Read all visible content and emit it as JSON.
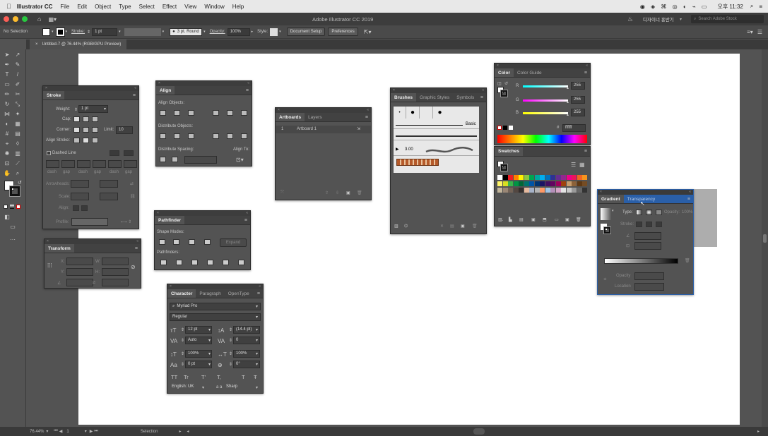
{
  "menubar": {
    "app": "Illustrator CC",
    "items": [
      "File",
      "Edit",
      "Object",
      "Type",
      "Select",
      "Effect",
      "View",
      "Window",
      "Help"
    ],
    "clock": "오후 11:32",
    "apple_icon": "apple-icon"
  },
  "appbar": {
    "title": "Adobe Illustrator CC 2019",
    "workspace": "디자이너 홍반기",
    "search_placeholder": "Search Adobe Stock"
  },
  "control": {
    "selection": "No Selection",
    "stroke_label": "Stroke:",
    "stroke_value": "1 pt",
    "brush": "3 pt. Round",
    "opacity_label": "Opacity:",
    "opacity_value": "100%",
    "style_label": "Style:",
    "doc_setup": "Document Setup",
    "preferences": "Preferences"
  },
  "doc_tab": "Untitled-7 @ 76.44% (RGB/GPU Preview)",
  "status": {
    "zoom": "76.44%",
    "page": "1",
    "tool": "Selection"
  },
  "stroke_panel": {
    "tab": "Stroke",
    "weight_label": "Weight:",
    "weight": "1 pt",
    "cap": "Cap:",
    "corner": "Corner:",
    "limit_label": "Limit:",
    "limit": "10",
    "x_label": "x",
    "align": "Align Stroke:",
    "dashed": "Dashed Line",
    "dash_labels": [
      "dash",
      "gap",
      "dash",
      "gap",
      "dash",
      "gap"
    ],
    "arrowheads": "Arrowheads:",
    "scale": "Scale:",
    "align2": "Align:",
    "profile": "Profile:"
  },
  "transform_panel": {
    "tab": "Transform",
    "x": "X:",
    "y": "Y:",
    "w": "W:",
    "h": "H:"
  },
  "align_panel": {
    "tab": "Align",
    "objects": "Align Objects:",
    "distribute": "Distribute Objects:",
    "spacing": "Distribute Spacing:",
    "align_to": "Align To:"
  },
  "pathfinder_panel": {
    "tab": "Pathfinder",
    "shape_modes": "Shape Modes:",
    "expand": "Expand",
    "pathfinders": "Pathfinders:"
  },
  "character_panel": {
    "tabs": [
      "Character",
      "Paragraph",
      "OpenType"
    ],
    "font": "Myriad Pro",
    "style": "Regular",
    "size": "12 pt",
    "leading": "(14.4 pt)",
    "kerning": "Auto",
    "tracking": "0",
    "vscale": "100%",
    "hscale": "100%",
    "baseline": "0 pt",
    "rotation": "0°",
    "lang": "English: UK",
    "aa_label": "a a",
    "aa": "Sharp",
    "tt_glyphs": [
      "TT",
      "Tr",
      "T'",
      "T,",
      "T",
      "Ŧ"
    ]
  },
  "artboards_panel": {
    "tabs": [
      "Artboards",
      "Layers"
    ],
    "row_num": "1",
    "row_name": "Artboard 1"
  },
  "brushes_panel": {
    "tabs": [
      "Brushes",
      "Graphic Styles",
      "Symbols"
    ],
    "basic": "Basic",
    "size": "3.00"
  },
  "color_panel": {
    "tabs": [
      "Color",
      "Color Guide"
    ],
    "r": "R",
    "g": "G",
    "b": "B",
    "rv": "255",
    "gv": "255",
    "bv": "255",
    "hash": "#",
    "hex": "ffffff"
  },
  "swatches_panel": {
    "tab": "Swatches"
  },
  "gradient_panel": {
    "tabs": [
      "Gradient",
      "Transparency"
    ],
    "type": "Type:",
    "opacity": "Opacity:",
    "opacity_val": "100%",
    "stroke": "Stroke:",
    "opacity2": "Opacity",
    "location": "Location"
  },
  "swatch_colors": [
    [
      "#ffffff",
      "#000000",
      "#ed1c24",
      "#ff7f00",
      "#fff200",
      "#8dc63f",
      "#00a651",
      "#00a99d",
      "#00aeef",
      "#0072bc",
      "#2e3192",
      "#662d91",
      "#92278f",
      "#ec008c",
      "#ed145b",
      "#f26522",
      "#f7941d"
    ],
    [
      "#fff568",
      "#d7df23",
      "#39b54a",
      "#009444",
      "#006838",
      "#00746b",
      "#0054a6",
      "#003471",
      "#1b1464",
      "#440e62",
      "#630460",
      "#9e005d",
      "#a0410d",
      "#c69c6d",
      "#8c6239",
      "#603913",
      "#754c24"
    ],
    [
      "#c2b59b",
      "#998675",
      "#736357",
      "#534741",
      "#362f2d",
      "#e6b99e",
      "#a6b2c8",
      "#b3b3b3",
      "#ff9966",
      "#a0c4e4",
      "#b58fb8",
      "#d4a4c6",
      "#e4e4e4",
      "#c8c8c8",
      "#999999",
      "#666666",
      "#333333"
    ]
  ]
}
